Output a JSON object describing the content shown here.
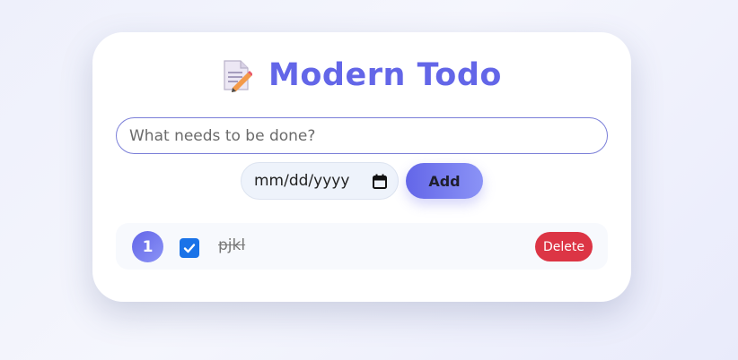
{
  "app": {
    "title": "Modern Todo",
    "title_icon": "memo-pencil-icon",
    "accent_color": "#6366e8"
  },
  "new_task": {
    "placeholder": "What needs to be done?",
    "value": ""
  },
  "due_date": {
    "placeholder": "mm/dd/yyyy",
    "icon": "calendar-icon"
  },
  "add_button": {
    "label": "Add"
  },
  "todos": [
    {
      "number": "1",
      "done": true,
      "text": "pjkl",
      "delete_label": "Delete"
    }
  ],
  "colors": {
    "delete": "#dc3545",
    "checkbox": "#1a73e8"
  }
}
